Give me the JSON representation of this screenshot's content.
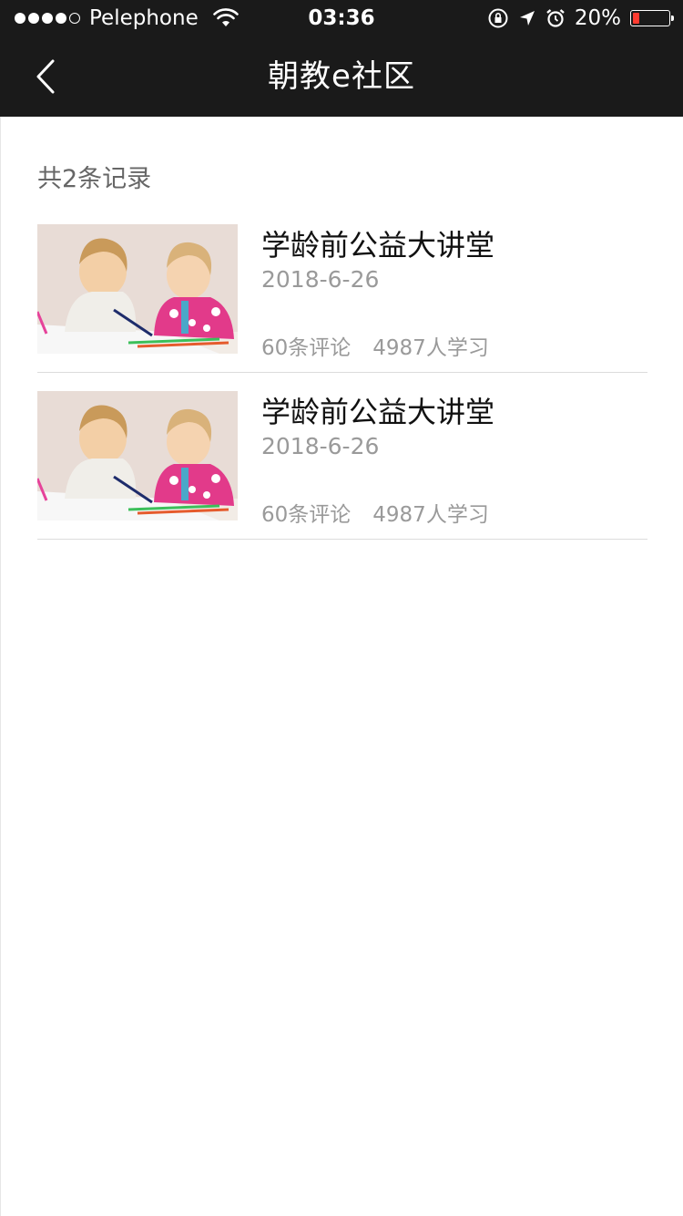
{
  "status_bar": {
    "carrier": "Pelephone",
    "time": "03:36",
    "battery_text": "20%",
    "battery_level": 0.2
  },
  "nav": {
    "title": "朝教e社区"
  },
  "record_count": "共2条记录",
  "courses": [
    {
      "title": "学龄前公益大讲堂",
      "date": "2018-6-26",
      "comments": "60条评论",
      "learners": "4987人学习"
    },
    {
      "title": "学龄前公益大讲堂",
      "date": "2018-6-26",
      "comments": "60条评论",
      "learners": "4987人学习"
    }
  ],
  "colors": {
    "header_bg": "#1a1a1a",
    "battery_low": "#ff3b30"
  }
}
